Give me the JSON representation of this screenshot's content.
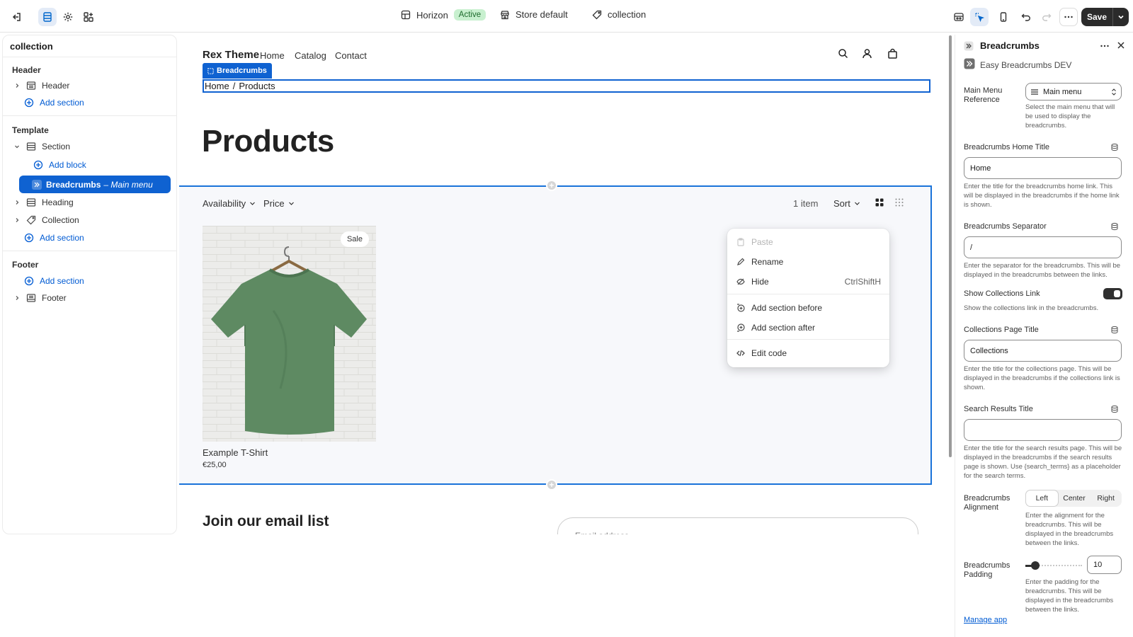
{
  "topbar": {
    "theme_name": "Horizon",
    "theme_status": "Active",
    "store": "Store default",
    "template": "collection",
    "save_label": "Save"
  },
  "sidebar": {
    "title": "collection",
    "groups": {
      "header": "Header",
      "template": "Template",
      "footer": "Footer"
    },
    "items": {
      "header": "Header",
      "add_section_1": "Add section",
      "section": "Section",
      "add_block": "Add block",
      "breadcrumbs": "Breadcrumbs",
      "breadcrumbs_sub": "– Main menu",
      "heading": "Heading",
      "collection": "Collection",
      "add_section_2": "Add section",
      "add_section_3": "Add section",
      "footer": "Footer"
    }
  },
  "preview": {
    "store_name": "Rex Theme",
    "nav": [
      "Home",
      "Catalog",
      "Contact"
    ],
    "block_tag": "Breadcrumbs",
    "breadcrumb": {
      "home": "Home",
      "sep": "/",
      "current": "Products"
    },
    "heading": "Products",
    "filters": {
      "availability": "Availability",
      "price": "Price",
      "count": "1 item",
      "sort": "Sort"
    },
    "product": {
      "badge": "Sale",
      "title": "Example T-Shirt",
      "price": "€25,00"
    },
    "email_heading": "Join our email list",
    "email_placeholder": "Email address"
  },
  "context_menu": {
    "paste": "Paste",
    "rename": "Rename",
    "hide": "Hide",
    "hide_shortcut": "CtrlShiftH",
    "add_before": "Add section before",
    "add_after": "Add section after",
    "edit_code": "Edit code"
  },
  "panel": {
    "title": "Breadcrumbs",
    "app_name": "Easy Breadcrumbs DEV",
    "main_menu": {
      "label": "Main Menu Reference",
      "value": "Main menu",
      "help": "Select the main menu that will be used to display the breadcrumbs."
    },
    "home_title": {
      "label": "Breadcrumbs Home Title",
      "value": "Home",
      "help": "Enter the title for the breadcrumbs home link. This will be displayed in the breadcrumbs if the home link is shown."
    },
    "separator": {
      "label": "Breadcrumbs Separator",
      "value": "/",
      "help": "Enter the separator for the breadcrumbs. This will be displayed in the breadcrumbs between the links."
    },
    "show_collections": {
      "label": "Show Collections Link",
      "help": "Show the collections link in the breadcrumbs.",
      "enabled": true
    },
    "collections_title": {
      "label": "Collections Page Title",
      "value": "Collections",
      "help": "Enter the title for the collections page. This will be displayed in the breadcrumbs if the collections link is shown."
    },
    "search_title": {
      "label": "Search Results Title",
      "value": "",
      "help": "Enter the title for the search results page. This will be displayed in the breadcrumbs if the search results page is shown. Use {search_terms} as a placeholder for the search terms."
    },
    "alignment": {
      "label": "Breadcrumbs Alignment",
      "options": [
        "Left",
        "Center",
        "Right"
      ],
      "selected": "Left",
      "help": "Enter the alignment for the breadcrumbs. This will be displayed in the breadcrumbs between the links."
    },
    "padding": {
      "label": "Breadcrumbs Padding",
      "value": "10",
      "help": "Enter the padding for the breadcrumbs. This will be displayed in the breadcrumbs between the links."
    },
    "manage_app": "Manage app"
  },
  "colors": {
    "accent": "#0f62d1",
    "active_badge_bg": "#c8f0cf",
    "shirt": "#5e8a62"
  }
}
